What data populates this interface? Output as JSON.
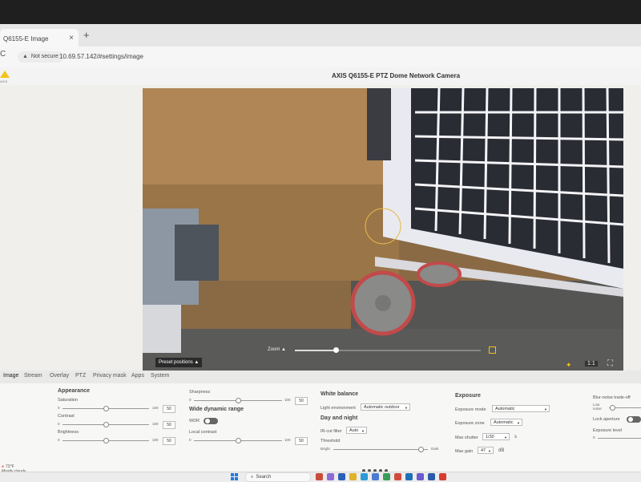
{
  "browser": {
    "tab_title": "Q6155-E Image",
    "tab_close": "×",
    "new_tab": "+",
    "reload": "C",
    "warning_icon": "▲",
    "not_secure": "Not secure",
    "url": "10.69.57.142/#settings/image"
  },
  "header": {
    "logo_text": "AXIS",
    "camera_title": "AXIS Q6155-E PTZ Dome Network Camera"
  },
  "video": {
    "preset_label": "Preset positions ▲",
    "zoom_label": "Zoom ▲",
    "zoom_level": 0.22,
    "ratio_label": "1:1",
    "scene_icon": "✦",
    "fullscreen_icon": "⛶"
  },
  "tabs": [
    {
      "label": "Image",
      "active": true
    },
    {
      "label": "Stream"
    },
    {
      "label": "Overlay"
    },
    {
      "label": "PTZ"
    },
    {
      "label": "Privacy mask"
    },
    {
      "label": "Apps"
    },
    {
      "label": "System"
    }
  ],
  "appearance": {
    "heading": "Appearance",
    "saturation": {
      "label": "Saturation",
      "min": "0",
      "max": "100",
      "value": "50",
      "level": 0.5
    },
    "contrast": {
      "label": "Contrast",
      "min": "0",
      "max": "100",
      "value": "50",
      "level": 0.5
    },
    "brightness": {
      "label": "Brightness",
      "min": "0",
      "max": "100",
      "value": "50",
      "level": 0.5
    }
  },
  "sharpness": {
    "label": "Sharpness",
    "min": "0",
    "max": "100",
    "value": "50",
    "level": 0.5
  },
  "wdr": {
    "heading": "Wide dynamic range",
    "wdr_label": "WDR",
    "local_contrast": {
      "label": "Local contrast",
      "min": "0",
      "max": "100",
      "value": "50",
      "level": 0.5
    }
  },
  "white_balance": {
    "heading": "White balance",
    "light_env_label": "Light environment",
    "light_env_value": "Automatic outdoor"
  },
  "day_night": {
    "heading": "Day and night",
    "ir_cut_label": "IR-cut filter",
    "ir_cut_value": "Auto",
    "threshold_label": "Threshold",
    "bright": "Bright",
    "dark": "Dark",
    "threshold_level": 0.92
  },
  "exposure": {
    "heading": "Exposure",
    "mode_label": "Exposure mode",
    "mode_value": "Automatic",
    "zone_label": "Exposure zone",
    "zone_value": "Automatic",
    "shutter_label": "Max shutter",
    "shutter_value": "1/30",
    "shutter_unit": "s",
    "gain_label": "Max gain",
    "gain_value": "47",
    "gain_unit": "dB"
  },
  "right_panel": {
    "blur_noise": "Blur-noise trade-off",
    "low_noise": "Low noise",
    "lock_aperture": "Lock aperture",
    "exposure_level": "Exposure level",
    "exposure_level_min": "0"
  },
  "taskbar": {
    "weather_temp": "73°F",
    "weather_desc": "Mostly cloudy",
    "search_placeholder": "Search",
    "search_icon": "⌕"
  }
}
